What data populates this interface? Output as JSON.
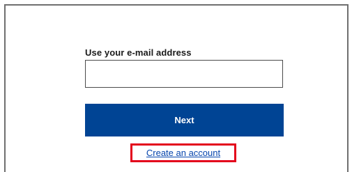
{
  "login_form": {
    "email_label": "Use your e-mail address",
    "email_value": "",
    "email_placeholder": "",
    "next_label": "Next",
    "create_account_label": "Create an account"
  },
  "colors": {
    "primary_button": "#004494",
    "link": "#0645ad",
    "highlight": "#e3001b",
    "panel_border": "#6f6f6f"
  }
}
